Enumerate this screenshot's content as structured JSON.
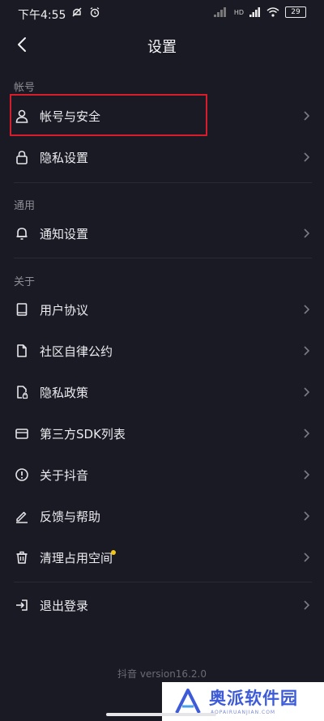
{
  "status_bar": {
    "time": "下午4:55",
    "battery": "29",
    "signal_label": "HD"
  },
  "header": {
    "title": "设置"
  },
  "sections": [
    {
      "label": "帐号"
    },
    {
      "label": "通用"
    },
    {
      "label": "关于"
    }
  ],
  "items": [
    {
      "label": "帐号与安全",
      "icon": "person-icon"
    },
    {
      "label": "隐私设置",
      "icon": "lock-icon"
    },
    {
      "label": "通知设置",
      "icon": "bell-icon"
    },
    {
      "label": "用户协议",
      "icon": "book-icon"
    },
    {
      "label": "社区自律公约",
      "icon": "document-icon"
    },
    {
      "label": "隐私政策",
      "icon": "privacy-document-icon"
    },
    {
      "label": "第三方SDK列表",
      "icon": "card-icon"
    },
    {
      "label": "关于抖音",
      "icon": "info-icon"
    },
    {
      "label": "反馈与帮助",
      "icon": "pen-icon"
    },
    {
      "label": "清理占用空间",
      "icon": "trash-icon"
    },
    {
      "label": "退出登录",
      "icon": "logout-icon"
    }
  ],
  "footer": {
    "version": "抖音 version16.2.0"
  },
  "watermark": {
    "title": "奥派软件园",
    "subtitle": "AOPAIRUANJIAN.COM"
  },
  "colors": {
    "background": "#1a1a25",
    "highlight": "#d71d2b",
    "new_dot": "#f3c615"
  }
}
